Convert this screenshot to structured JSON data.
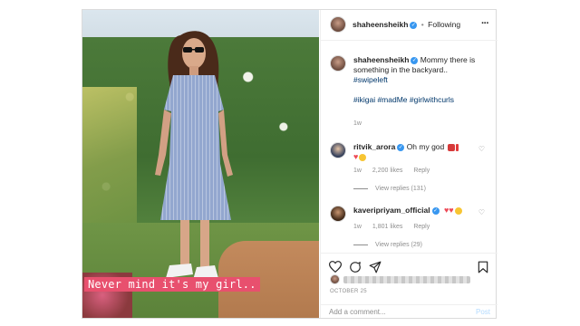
{
  "post": {
    "author": "shaheensheikh",
    "follow_status": "Following",
    "separator": "•",
    "more_icon": "more-horizontal-icon",
    "caption_overlay": "Never mind it's my girl..",
    "caption": {
      "text_line1": "Mommy there is",
      "text_line2": "something in the backyard..",
      "hashtag1": "#swipeleft",
      "hashtags2": "#ikigai #madMe #girlwithcurls",
      "age": "1w"
    },
    "comments": [
      {
        "author": "ritvik_arora",
        "text": "Oh my god",
        "age": "1w",
        "likes": "2,200 likes",
        "reply": "Reply",
        "view_replies": "View replies (131)"
      },
      {
        "author": "kaveripriyam_official",
        "text": "",
        "age": "1w",
        "likes": "1,801 likes",
        "reply": "Reply",
        "view_replies": "View replies (29)"
      }
    ],
    "date": "OCTOBER 25",
    "add_comment_placeholder": "Add a comment...",
    "post_button": "Post"
  },
  "colors": {
    "verified": "#3897f0",
    "overlay_bar": "#e8506e",
    "heart_red": "#ed4956",
    "link": "#00376b"
  }
}
